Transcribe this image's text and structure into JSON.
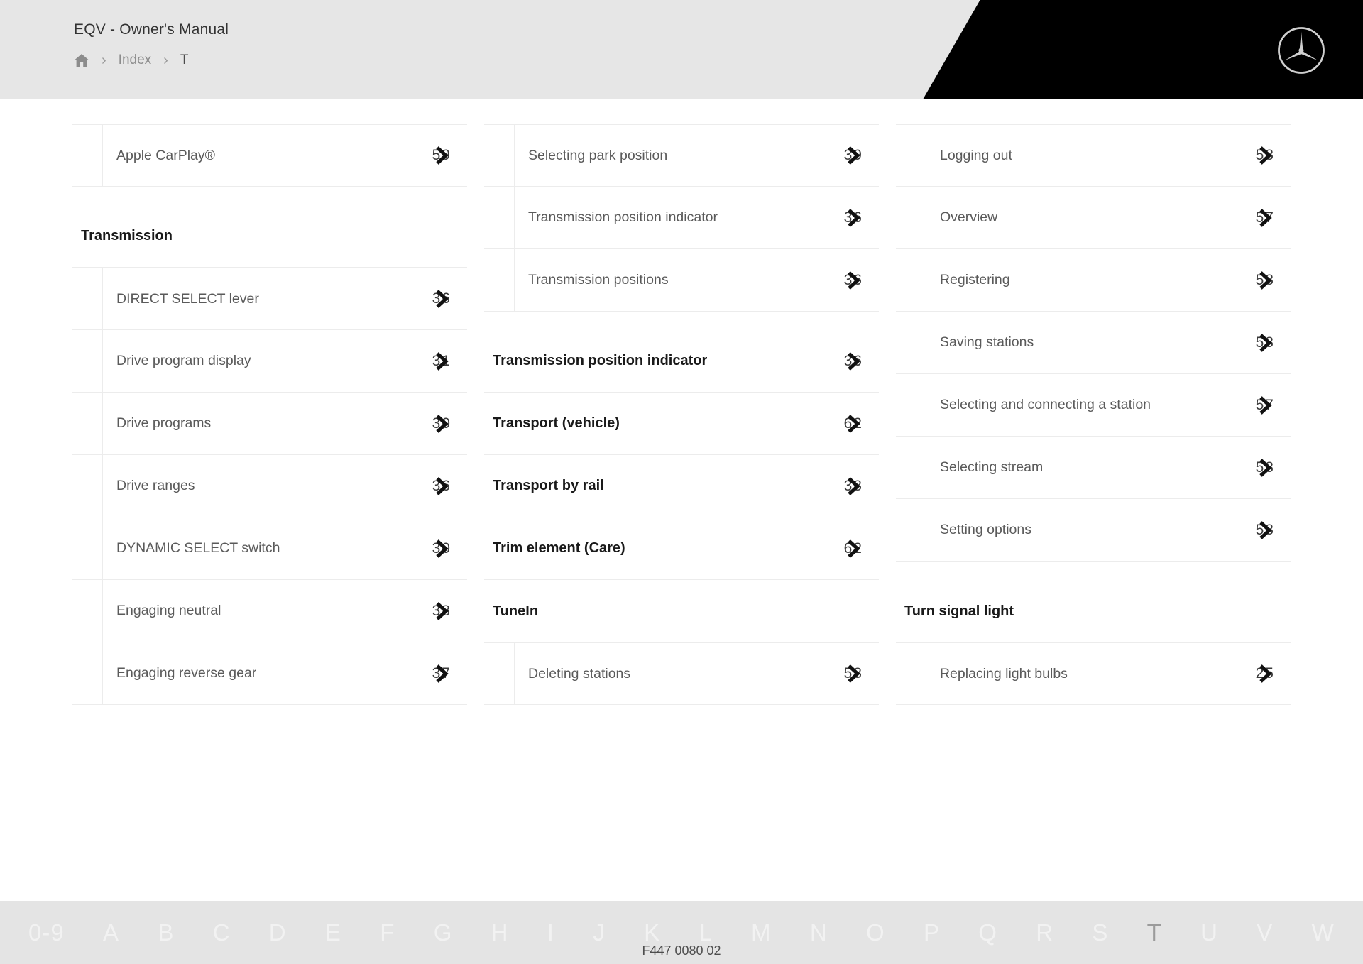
{
  "header": {
    "doc_title": "EQV - Owner's Manual",
    "breadcrumb": {
      "home_icon": "home-icon",
      "separator": "›",
      "items": [
        "Index",
        "T"
      ]
    },
    "brand_logo": "mercedes-benz-star-icon"
  },
  "columns": [
    {
      "id": "column-1",
      "blocks": [
        {
          "type": "sub-group",
          "entries": [
            {
              "label": "Apple CarPlay®",
              "page_prefix": "5",
              "page_suffix": "9"
            }
          ]
        },
        {
          "type": "heading",
          "label": "Transmission",
          "page_prefix": "",
          "page_suffix": ""
        },
        {
          "type": "sub-group",
          "entries": [
            {
              "label": "DIRECT SELECT lever",
              "page_prefix": "3",
              "page_suffix": "6"
            },
            {
              "label": "Drive program display",
              "page_prefix": "3",
              "page_suffix": "1"
            },
            {
              "label": "Drive programs",
              "page_prefix": "3",
              "page_suffix": "0"
            },
            {
              "label": "Drive ranges",
              "page_prefix": "3",
              "page_suffix": "6"
            },
            {
              "label": "DYNAMIC SELECT switch",
              "page_prefix": "3",
              "page_suffix": "0"
            },
            {
              "label": "Engaging neutral",
              "page_prefix": "3",
              "page_suffix": "8"
            },
            {
              "label": "Engaging reverse gear",
              "page_prefix": "3",
              "page_suffix": "7"
            }
          ]
        }
      ]
    },
    {
      "id": "column-2",
      "blocks": [
        {
          "type": "sub-group",
          "entries": [
            {
              "label": "Selecting park position",
              "page_prefix": "3",
              "page_suffix": "9"
            },
            {
              "label": "Transmission position indicator",
              "page_prefix": "3",
              "page_suffix": "6"
            },
            {
              "label": "Transmission positions",
              "page_prefix": "3",
              "page_suffix": "6"
            }
          ]
        },
        {
          "type": "heading",
          "label": "Transmission position indicator",
          "page_prefix": "3",
          "page_suffix": "6"
        },
        {
          "type": "heading",
          "label": "Transport (vehicle)",
          "page_prefix": "6",
          "page_suffix": "2"
        },
        {
          "type": "heading",
          "label": "Transport by rail",
          "page_prefix": "3",
          "page_suffix": "8"
        },
        {
          "type": "heading",
          "label": "Trim element (Care)",
          "page_prefix": "6",
          "page_suffix": "2"
        },
        {
          "type": "heading-nopage",
          "label": "TuneIn",
          "page_prefix": "",
          "page_suffix": ""
        },
        {
          "type": "sub-group",
          "entries": [
            {
              "label": "Deleting stations",
              "page_prefix": "5",
              "page_suffix": "8"
            }
          ]
        }
      ]
    },
    {
      "id": "column-3",
      "blocks": [
        {
          "type": "sub-group",
          "entries": [
            {
              "label": "Logging out",
              "page_prefix": "5",
              "page_suffix": "8"
            },
            {
              "label": "Overview",
              "page_prefix": "5",
              "page_suffix": "7"
            },
            {
              "label": "Registering",
              "page_prefix": "5",
              "page_suffix": "8"
            },
            {
              "label": "Saving stations",
              "page_prefix": "5",
              "page_suffix": "8"
            },
            {
              "label": "Selecting and connecting a station",
              "page_prefix": "5",
              "page_suffix": "7"
            },
            {
              "label": "Selecting stream",
              "page_prefix": "5",
              "page_suffix": "8"
            },
            {
              "label": "Setting options",
              "page_prefix": "5",
              "page_suffix": "8"
            }
          ]
        },
        {
          "type": "heading-nopage",
          "label": "Turn signal light",
          "page_prefix": "",
          "page_suffix": ""
        },
        {
          "type": "sub-group",
          "entries": [
            {
              "label": "Replacing light bulbs",
              "page_prefix": "2",
              "page_suffix": "5"
            }
          ]
        }
      ]
    }
  ],
  "footer": {
    "alphabet": [
      "0-9",
      "A",
      "B",
      "C",
      "D",
      "E",
      "F",
      "G",
      "H",
      "I",
      "J",
      "K",
      "L",
      "M",
      "N",
      "O",
      "P",
      "Q",
      "R",
      "S",
      "T",
      "U",
      "V",
      "W"
    ],
    "active_letter": "T",
    "document_code": "F447 0080 02"
  }
}
